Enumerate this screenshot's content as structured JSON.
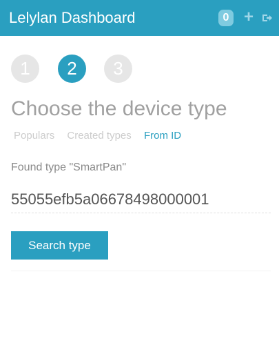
{
  "header": {
    "title": "Lelylan Dashboard",
    "count": "0",
    "add_icon": "plus-icon",
    "logout_icon": "logout-icon",
    "color": "#2a9fc0"
  },
  "steps": [
    {
      "label": "1",
      "active": false
    },
    {
      "label": "2",
      "active": true
    },
    {
      "label": "3",
      "active": false
    }
  ],
  "main": {
    "title": "Choose the device type",
    "tabs": [
      {
        "label": "Populars",
        "active": false
      },
      {
        "label": "Created types",
        "active": false
      },
      {
        "label": "From ID",
        "active": true
      }
    ],
    "found_label": "Found type \"SmartPan\"",
    "id_value": "55055efb5a06678498000001",
    "search_label": "Search type"
  }
}
